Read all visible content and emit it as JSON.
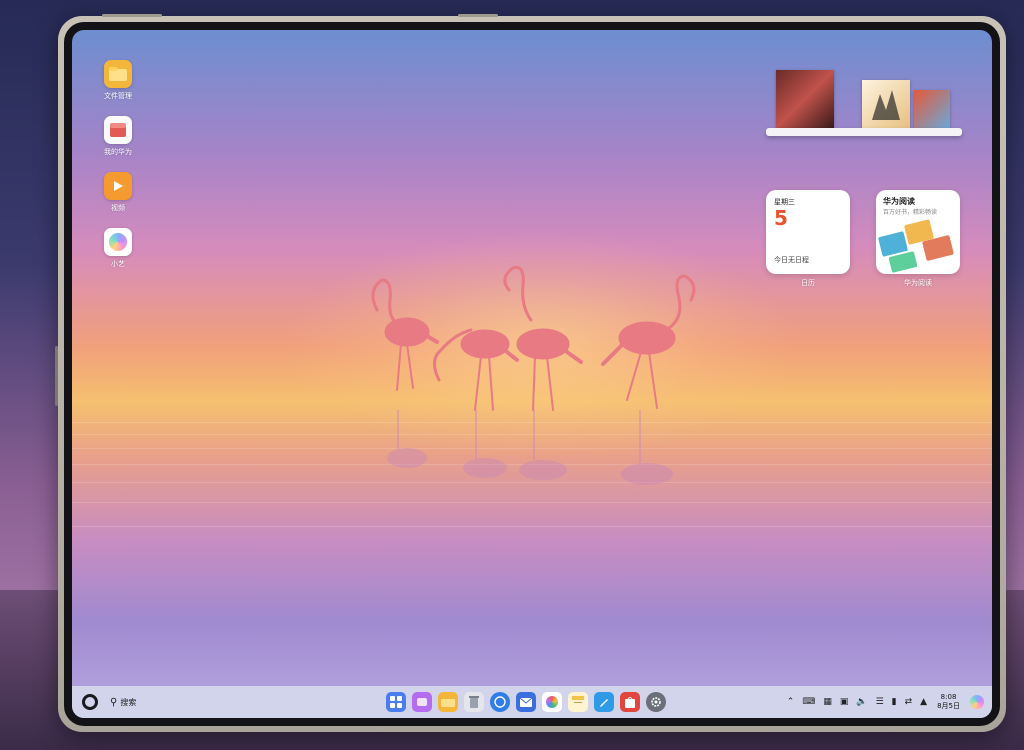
{
  "desktop": {
    "icons": [
      {
        "label": "文件管理",
        "icon": "folder-icon",
        "color": "#f4b63a"
      },
      {
        "label": "我的华为",
        "icon": "huawei-box-icon",
        "color": "#e25a56"
      },
      {
        "label": "视频",
        "icon": "video-play-icon",
        "color": "#f59a2f"
      },
      {
        "label": "小艺",
        "icon": "xiaoyi-orb-icon",
        "color": "#8f7cf0"
      }
    ]
  },
  "widgets": {
    "calendar": {
      "weekday": "星期三",
      "day": "5",
      "status": "今日无日程",
      "label": "日历"
    },
    "reader": {
      "title": "华为阅读",
      "subtitle": "百万好书，精彩畅读",
      "label": "华为阅读"
    }
  },
  "taskbar": {
    "search_label": "搜索",
    "dock": [
      {
        "icon": "app-grid-icon",
        "color": "#4a7df0"
      },
      {
        "icon": "multitask-icon",
        "color": "#b46cf0"
      },
      {
        "icon": "folder-icon",
        "color": "#f4b63a"
      },
      {
        "icon": "trash-icon",
        "color": "#9aa0ad"
      },
      {
        "icon": "browser-icon",
        "color": "#2f7de8"
      },
      {
        "icon": "email-icon",
        "color": "#3b6fe0"
      },
      {
        "icon": "gallery-icon",
        "color": "#f0a040"
      },
      {
        "icon": "notes-icon",
        "color": "#f2c24a"
      },
      {
        "icon": "pen-icon",
        "color": "#2f9be8"
      },
      {
        "icon": "app-store-icon",
        "color": "#e2463f"
      },
      {
        "icon": "settings-icon",
        "color": "#6b6f78"
      }
    ],
    "time": "8:08",
    "date": "8月5日"
  }
}
